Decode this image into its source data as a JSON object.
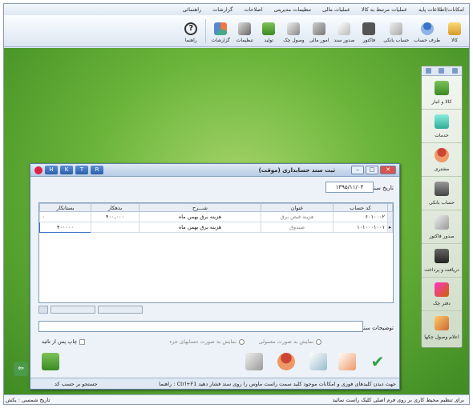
{
  "menubar": [
    "امکانات/اطلاعات پایه",
    "عملیات مرتبط به کالا",
    "عملیات مالی",
    "تنظیمات مدیریتی",
    "اصلاحات",
    "گزارشات",
    "راهنمائی"
  ],
  "toolbar": [
    {
      "label": "کالا",
      "icon": "box-icon"
    },
    {
      "label": "طرف حساب",
      "icon": "person-icon"
    },
    {
      "label": "حساب بانکی",
      "icon": "bank-card-icon"
    },
    {
      "label": "فاکتور",
      "icon": "calculator-icon"
    },
    {
      "label": "صدور سند",
      "icon": "pen-document-icon"
    },
    {
      "label": "امور مالی",
      "icon": "tools-icon"
    },
    {
      "label": "وصول چک",
      "icon": "check-receive-icon"
    },
    {
      "label": "تولید",
      "icon": "production-icon"
    },
    {
      "label": "تنظیمات",
      "icon": "settings-icon"
    },
    {
      "label": "گزارشات",
      "icon": "reports-icon"
    },
    {
      "label": "راهنما",
      "icon": "help-icon"
    }
  ],
  "rightpanel": [
    {
      "label": "کالا و انبار",
      "icon": "box-warehouse-icon"
    },
    {
      "label": "خدمات",
      "icon": "services-icon"
    },
    {
      "label": "مشتری",
      "icon": "customer-icon"
    },
    {
      "label": "حساب بانکی",
      "icon": "bank-icon"
    },
    {
      "label": "صدور فاکتور",
      "icon": "invoice-icon"
    },
    {
      "label": "دریافت و پرداخت",
      "icon": "receive-pay-icon"
    },
    {
      "label": "دفتر چک",
      "icon": "checkbook-icon"
    },
    {
      "label": "اعلام وصول چکها",
      "icon": "check-collect-icon"
    }
  ],
  "dialog": {
    "title": "ثبت سند حسابداری (موقت)",
    "hotkeys": [
      "H",
      "K",
      "T",
      "R"
    ],
    "date_label": "تاریخ سند",
    "date_value": "۱۳۹۵/۱۱/۰۴",
    "columns": [
      "کد حساب",
      "عنوان",
      "شـــرح",
      "بدهکار",
      "بستانکار"
    ],
    "rows": [
      {
        "code": "۶۰۱۰۰۰۲",
        "title": "هزینه قبض برق",
        "desc": "هزینه برق بهمن ماه",
        "debit": "۴۰۰,۰۰۰",
        "credit": "۰"
      },
      {
        "code": "۱۰۱۰۰۰۱۰۰۱",
        "title": "صندوق",
        "desc": "هزینه برق بهمن ماه",
        "debit": "",
        "credit": "۴۰۰۰۰۰"
      }
    ],
    "desc_label": "توضیحات سند",
    "option_normal": "نمایش به صورت معمولی",
    "option_partial": "نمایش به صورت حسابهای جزء",
    "print_label": "چاپ پس از تائید",
    "status_hint": "راهنما : Ctrl+F1 جهت دیدن کلیدهای فوری و امکانات موجود کلید سمت راست ماوس را روی سند فشار دهید",
    "status_search": "جستجو بر حسب کد"
  },
  "statusbar": {
    "right": "برای تنظیم محیط کاری بر روی فرم اصلی کلیک راست نمائید",
    "left": "تاریخ شمسی : یکش"
  },
  "colors": {
    "accent": "#2d5fa8",
    "workarea": "#6ab43a",
    "close": "#d9534f",
    "ok": "#2ea043"
  }
}
